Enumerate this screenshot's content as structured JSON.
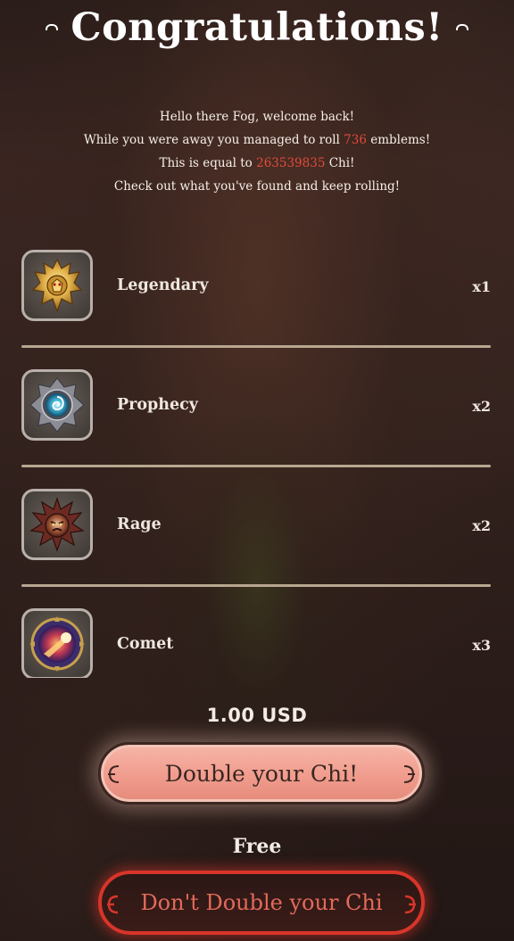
{
  "header": {
    "title": "Congratulations!"
  },
  "message": {
    "line1": "Hello there Fog, welcome back!",
    "line2_prefix": "While you were away you managed to roll ",
    "emblem_count": "736",
    "line2_suffix": " emblems!",
    "line3_prefix": "This is equal to ",
    "chi_amount": "263539835",
    "line3_suffix": " Chi!",
    "line4": "Check out what you've found and keep rolling!"
  },
  "emblems": [
    {
      "name": "Legendary",
      "count": "x1",
      "icon": "legendary-emblem-icon"
    },
    {
      "name": "Prophecy",
      "count": "x2",
      "icon": "prophecy-emblem-icon"
    },
    {
      "name": "Rage",
      "count": "x2",
      "icon": "rage-emblem-icon"
    },
    {
      "name": "Comet",
      "count": "x3",
      "icon": "comet-emblem-icon"
    }
  ],
  "offer": {
    "price": "1.00 USD",
    "double_label": "Double your Chi!",
    "free_label": "Free",
    "dont_double_label": "Don't Double your Chi"
  },
  "colors": {
    "highlight": "#e24a3c",
    "primary_button": "#f09c8d",
    "secondary_border": "#d8352a",
    "divider": "#b8a790"
  }
}
